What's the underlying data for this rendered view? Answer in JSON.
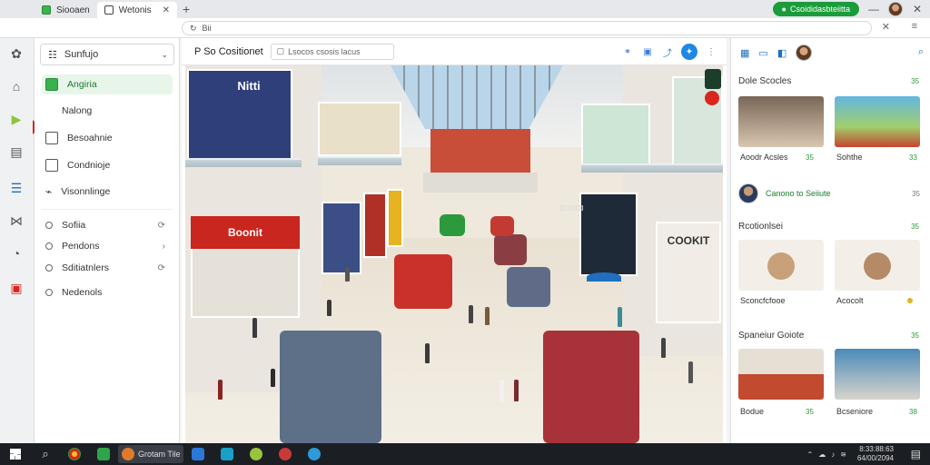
{
  "browser": {
    "tabs": [
      {
        "label": "Siooaen",
        "active": false
      },
      {
        "label": "Wetonis",
        "active": true
      }
    ],
    "new_tab_symbol": "+",
    "close_symbol": "✕",
    "account_button": "Csoididasbteiitta",
    "address": "Bii",
    "address_close": "✕",
    "menu_symbol": "≡",
    "window_controls": [
      "—",
      "✕"
    ]
  },
  "rail": {
    "icons": [
      "puzzle-icon",
      "home-icon",
      "play-icon",
      "grid-icon",
      "list-icon",
      "share-icon",
      "gauge-icon",
      "layers-icon"
    ]
  },
  "sidepanel": {
    "dropdown_label": "Sunfujo",
    "items": [
      {
        "label": "Angiria",
        "active": true
      },
      {
        "label": "Nalong",
        "active": false
      },
      {
        "label": "Besoahnie",
        "active": false
      },
      {
        "label": "Condnioje",
        "active": false
      },
      {
        "label": "Visonnlinge",
        "active": false
      }
    ],
    "subitems": [
      {
        "label": "Sofiia",
        "trail": "⟳"
      },
      {
        "label": "Pendons",
        "trail": "›"
      },
      {
        "label": "Sditiatnlers",
        "trail": "⟳"
      },
      {
        "label": "Nedenols",
        "trail": ""
      }
    ]
  },
  "main": {
    "title": "P So Cositionet",
    "search_text": "Lsocos csosis lacus",
    "store_signs": [
      "Nitti",
      "Boonit",
      "COOKIT",
      "BOOOI"
    ]
  },
  "rightpanel": {
    "section1": {
      "heading": "Dole Scocles",
      "badge": "35"
    },
    "cards1": [
      {
        "caption": "Aoodr Acsles",
        "badge": "35"
      },
      {
        "caption": "Sohthe",
        "badge": "33"
      }
    ],
    "user": {
      "name": "Canono to Seiiute",
      "count": "35"
    },
    "section2": {
      "heading": "Rcotionlsei",
      "badge": "35"
    },
    "cards2": [
      {
        "caption": "Sconcfcfooe",
        "badge": ""
      },
      {
        "caption": "Acocolt",
        "badge": ""
      }
    ],
    "section3": {
      "heading": "Spaneiur Goiote",
      "badge": "35"
    },
    "cards3": [
      {
        "caption": "Bodue",
        "badge": "35"
      },
      {
        "caption": "Bcseniore",
        "badge": "38"
      }
    ]
  },
  "taskbar": {
    "active_app_label": "Grotam Tile",
    "clock_time": "8:33:88:63",
    "clock_date": "64/00/2094"
  },
  "colors": {
    "brand_red": "#d8261d",
    "brand_green": "#1b9c3a",
    "accent_blue": "#1f88e5"
  }
}
